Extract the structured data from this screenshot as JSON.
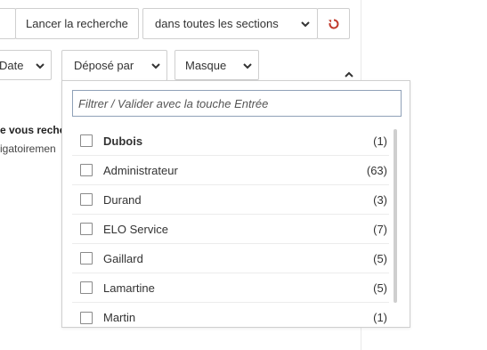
{
  "toolbar": {
    "search_button": "Lancer la recherche",
    "section_select": "dans toutes les sections",
    "reset_icon": "refresh-icon"
  },
  "filters": {
    "date_label": "Date",
    "deposited_by_label": "Déposé par",
    "mask_label": "Masque"
  },
  "background_text": {
    "line1": "e vous reche",
    "line2": "igatoiremen"
  },
  "dropdown": {
    "filter_placeholder": "Filtrer / Valider avec la touche Entrée",
    "items": [
      {
        "name": "Dubois",
        "count": "(1)",
        "bold": true
      },
      {
        "name": "Administrateur",
        "count": "(63)"
      },
      {
        "name": "Durand",
        "count": "(3)"
      },
      {
        "name": "ELO Service",
        "count": "(7)"
      },
      {
        "name": "Gaillard",
        "count": "(5)"
      },
      {
        "name": "Lamartine",
        "count": "(5)"
      },
      {
        "name": "Martin",
        "count": "(1)"
      }
    ]
  },
  "colors": {
    "accent_red": "#c0392b",
    "border": "#cfcfcf"
  }
}
